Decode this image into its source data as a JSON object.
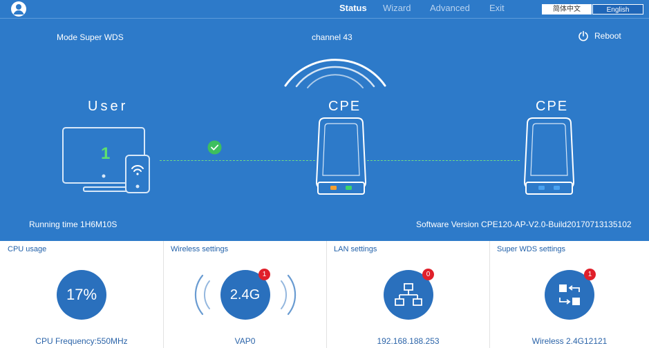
{
  "nav": {
    "tabs": [
      {
        "label": "Status"
      },
      {
        "label": "Wizard"
      },
      {
        "label": "Advanced"
      },
      {
        "label": "Exit"
      }
    ],
    "active": "Status"
  },
  "lang": {
    "zh": "简体中文",
    "en": "English"
  },
  "header": {
    "mode": "Mode  Super  WDS",
    "channel": "channel 43",
    "reboot": "Reboot"
  },
  "topology": {
    "user_label": "User",
    "user_count": "1",
    "cpe1_label": "CPE",
    "cpe2_label": "CPE"
  },
  "status": {
    "running_time": "Running time  1H6M10S",
    "software_version": "Software Version   CPE120-AP-V2.0-Build20170713135102"
  },
  "panels": {
    "cpu": {
      "title": "CPU usage",
      "value": "17%",
      "footer": "CPU Frequency:550MHz"
    },
    "wireless": {
      "title": "Wireless settings",
      "value": "2.4G",
      "badge": "1",
      "footer": "VAP0"
    },
    "lan": {
      "title": "LAN settings",
      "badge": "0",
      "footer": "192.168.188.253"
    },
    "wds": {
      "title": "Super WDS settings",
      "badge": "1",
      "footer": "Wireless 2.4G12121"
    }
  },
  "colors": {
    "primary": "#2d7ac9",
    "circle": "#2a70bd",
    "badge": "#e0202a",
    "link_line": "#6fdc86"
  }
}
